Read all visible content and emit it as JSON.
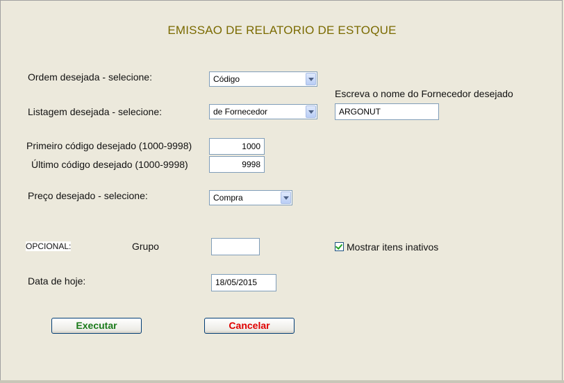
{
  "title": "EMISSAO DE RELATORIO DE ESTOQUE",
  "ordem": {
    "label": "Ordem desejada - selecione:",
    "value": "Código"
  },
  "fornecedor": {
    "label": "Escreva o nome do Fornecedor desejado",
    "value": "ARGONUT"
  },
  "listagem": {
    "label": "Listagem desejada - selecione:",
    "value": "de Fornecedor"
  },
  "primeiro": {
    "label": "Primeiro código desejado  (1000-9998)",
    "value": "1000"
  },
  "ultimo": {
    "label": "Último  código  desejado (1000-9998)",
    "value": "9998"
  },
  "preco": {
    "label": "Preço desejado - selecione:",
    "value": "Compra"
  },
  "opcional": {
    "label": "OPCIONAL:"
  },
  "grupo": {
    "label": "Grupo",
    "value": ""
  },
  "mostrar_inativos": {
    "label": "Mostrar itens inativos",
    "checked": true
  },
  "data": {
    "label": "Data de hoje:",
    "value": "18/05/2015"
  },
  "buttons": {
    "executar": "Executar",
    "cancelar": "Cancelar"
  },
  "colors": {
    "title": "#7a6a00",
    "executar_text": "#1a7a1a",
    "cancelar_text": "#e00000",
    "background": "#ece9dc"
  }
}
